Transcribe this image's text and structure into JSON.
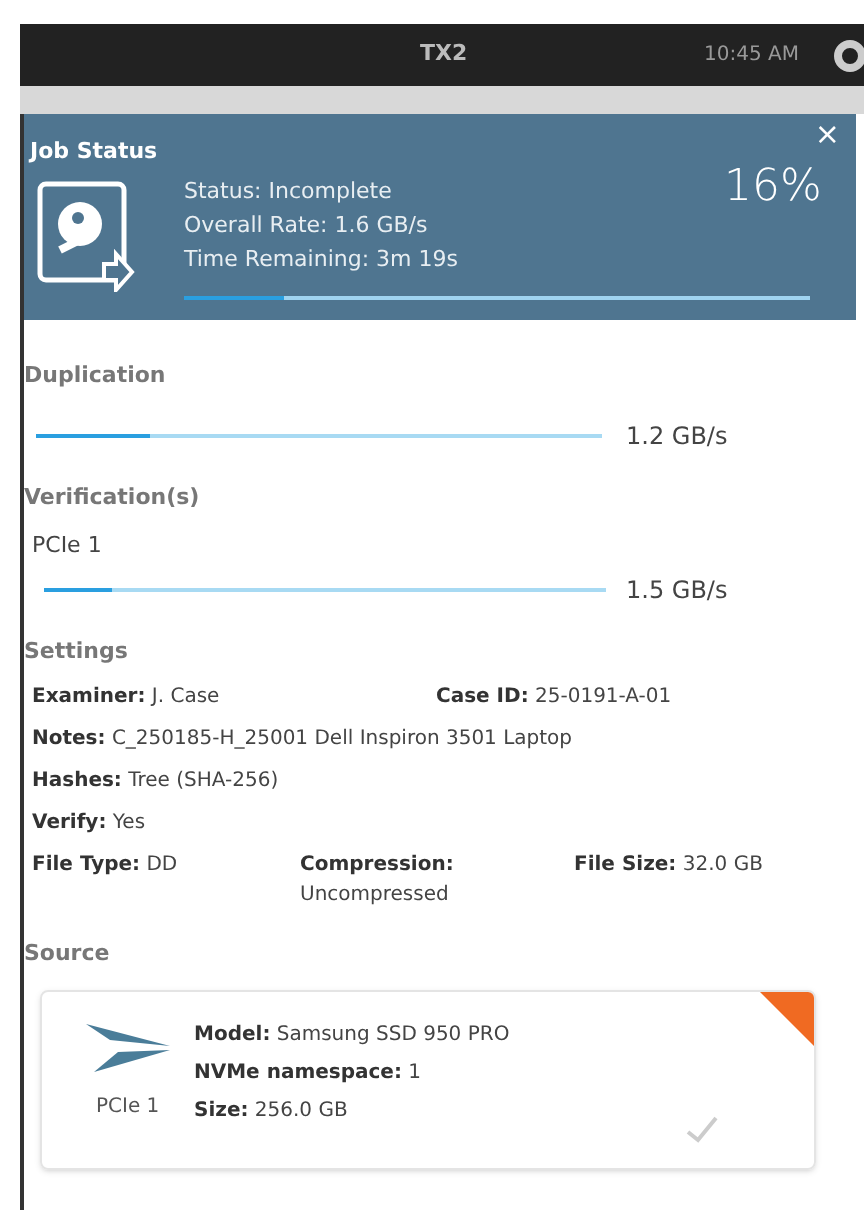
{
  "top_bar": {
    "title": "TX2",
    "time": "10:45 AM"
  },
  "job_status": {
    "title": "Job Status",
    "percent": "16%",
    "close": "×",
    "lines": [
      "Status: Incomplete",
      "Overall Rate: 1.6 GB/s",
      "Time Remaining: 3m 19s"
    ],
    "level": 0.16
  },
  "duplication": {
    "heading": "Duplication",
    "level": 0.2,
    "reading": "1.2 GB/s"
  },
  "verifications": {
    "heading": "Verification(s)",
    "items": [
      {
        "label": "PCIe 1",
        "level": 0.12,
        "reading": "1.5 GB/s"
      }
    ]
  },
  "settings": {
    "heading": "Settings",
    "rows": [
      [
        {
          "label": "Examiner:",
          "value": "J. Case"
        },
        {
          "label": "Case ID:",
          "value": "25-0191-A-01"
        }
      ],
      [
        {
          "label": "Notes:",
          "value": "C_250185-H_25001 Dell Inspiron 3501 Laptop"
        }
      ],
      [
        {
          "label": "Hashes:",
          "value": "Tree (SHA-256)"
        }
      ],
      [
        {
          "label": "Verify:",
          "value": "Yes"
        }
      ],
      [
        {
          "label": "File Type:",
          "value": "DD"
        },
        {
          "label": "Compression:",
          "value": "Uncompressed"
        },
        {
          "label": "File Size:",
          "value": "32.0 GB"
        }
      ]
    ]
  },
  "source": {
    "heading": "Source",
    "label": "PCIe 1",
    "fields": [
      {
        "label": "Model:",
        "value": "Samsung SSD 950 PRO"
      },
      {
        "label": "NVMe namespace:",
        "value": "1"
      },
      {
        "label": "Size:",
        "value": "256.0 GB"
      }
    ]
  }
}
